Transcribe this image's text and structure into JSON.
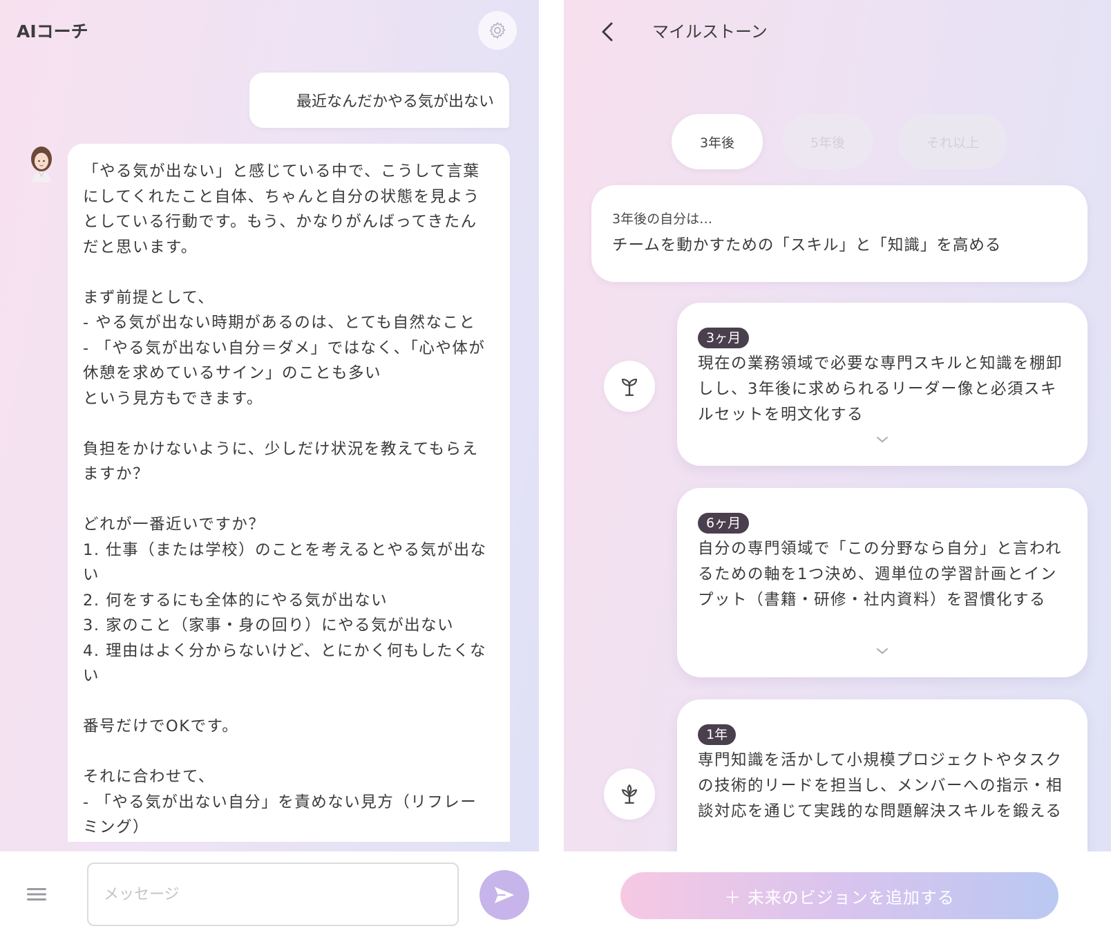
{
  "chat": {
    "title": "AIコーチ",
    "user_message": "最近なんだかやる気が出ない",
    "bot_message": "「やる気が出ない」と感じている中で、こうして言葉にしてくれたこと自体、ちゃんと自分の状態を見ようとしている行動です。もう、かなりがんばってきたんだと思います。\n\nまず前提として、\n- やる気が出ない時期があるのは、とても自然なこと\n- 「やる気が出ない自分＝ダメ」ではなく、「心や体が休憩を求めているサイン」のことも多い\nという見方もできます。\n\n負担をかけないように、少しだけ状況を教えてもらえますか？\n\nどれが一番近いですか？\n1. 仕事（または学校）のことを考えるとやる気が出ない\n2. 何をするにも全体的にやる気が出ない\n3. 家のこと（家事・身の回り）にやる気が出ない\n4. 理由はよく分からないけど、とにかく何もしたくない\n\n番号だけでOKです。\n\nそれに合わせて、\n- 「やる気が出ない自分」を責めない見方（リフレーミング）",
    "input_placeholder": "メッセージ"
  },
  "milestones": {
    "title": "マイルストーン",
    "tabs": [
      {
        "label": "3年後",
        "active": true
      },
      {
        "label": "5年後",
        "active": false
      },
      {
        "label": "それ以上",
        "active": false
      }
    ],
    "vision": {
      "label": "3年後の自分は…",
      "text": "チームを動かすための「スキル」と「知識」を高める"
    },
    "items": [
      {
        "badge": "3ヶ月",
        "icon": "sprout-icon",
        "text": "現在の業務領域で必要な専門スキルと知識を棚卸しし、3年後に求められるリーダー像と必須スキルセットを明文化する"
      },
      {
        "badge": "6ヶ月",
        "icon": "",
        "text": "自分の専門領域で「この分野なら自分」と言われるための軸を1つ決め、週単位の学習計画とインプット（書籍・研修・社内資料）を習慣化する"
      },
      {
        "badge": "1年",
        "icon": "plant-icon",
        "text": "専門知識を活かして小規模プロジェクトやタスクの技術的リードを担当し、メンバーへの指示・相談対応を通じて実践的な問題解決スキルを鍛える"
      }
    ],
    "add_button": "＋ 未来のビジョンを追加する"
  },
  "colors": {
    "send_button": "#c7b4ea",
    "badge": "#4a3f4d",
    "add_button_start": "#f6c9e3",
    "add_button_end": "#b9c8f2"
  }
}
